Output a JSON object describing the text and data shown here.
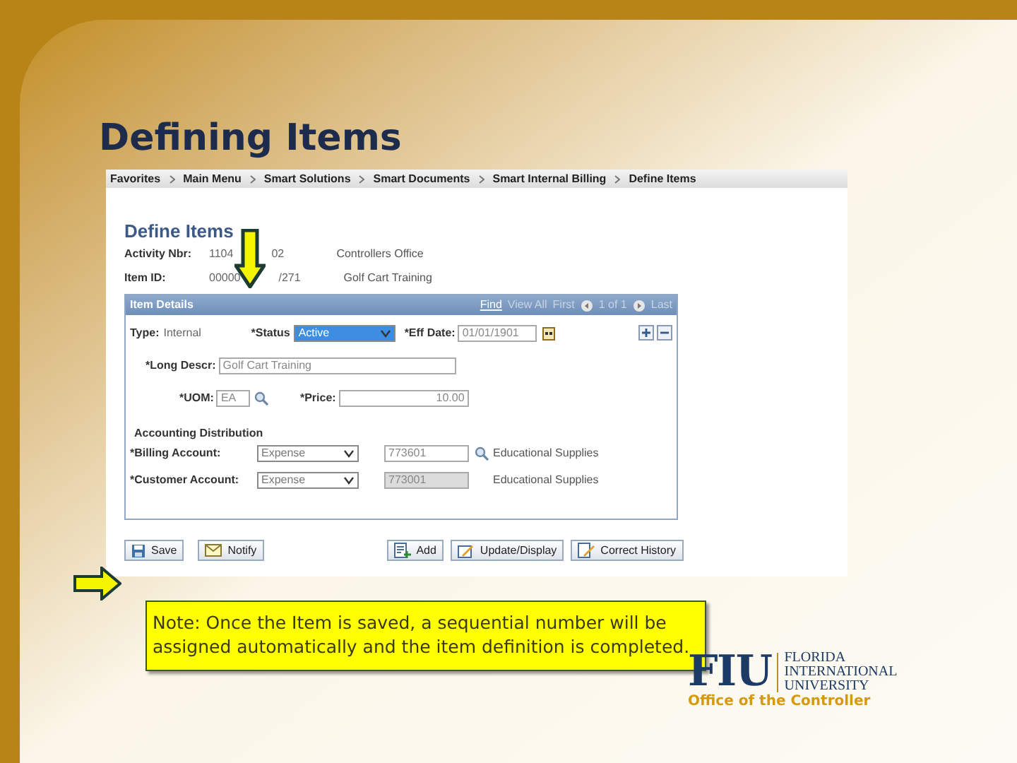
{
  "slide_title": "Defining Items",
  "breadcrumbs": [
    "Favorites",
    "Main Menu",
    "Smart Solutions",
    "Smart Documents",
    "Smart Internal Billing",
    "Define Items"
  ],
  "page_title": "Define Items",
  "header_fields": [
    {
      "label": "Activity Nbr:",
      "value_start": "1104",
      "value_end": "02",
      "description": "Controllers Office"
    },
    {
      "label": "Item ID:",
      "value_start": "00000",
      "value_end": "/271",
      "description": "Golf Cart Training"
    }
  ],
  "item_details": {
    "title": "Item Details",
    "nav": [
      "Find",
      "View All",
      "First",
      "1 of 1",
      "Last"
    ],
    "type_label": "Type:",
    "type_value": "Internal",
    "status": {
      "label": "*Status",
      "value": "Active"
    },
    "eff_date": {
      "label": "*Eff Date:",
      "value": "01/01/1901"
    },
    "long_descr": {
      "label": "*Long Descr:",
      "value": "Golf Cart Training"
    },
    "uom": {
      "label": "*UOM:",
      "value": "EA"
    },
    "price": {
      "label": "*Price:",
      "value": "10.00"
    },
    "section": "Accounting Distribution",
    "accounts": [
      {
        "label": "*Billing Account:",
        "type": "Expense",
        "account": "773601",
        "disabled": false,
        "description": "Educational Supplies"
      },
      {
        "label": "*Customer Account:",
        "type": "Expense",
        "account": "773001",
        "disabled": true,
        "description": "Educational Supplies"
      }
    ]
  },
  "buttons_left": [
    {
      "label": "Save",
      "kind": "save"
    },
    {
      "label": "Notify",
      "kind": "notify"
    }
  ],
  "buttons_right": [
    {
      "label": "Add",
      "kind": "add"
    },
    {
      "label": "Update/Display",
      "kind": "update"
    },
    {
      "label": "Correct History",
      "kind": "history"
    }
  ],
  "note": "Note: Once the Item is saved, a sequential number will be assigned automatically and the item definition is completed.",
  "logo": {
    "letters": "FIU",
    "lines": [
      "FLORIDA",
      "INTERNATIONAL",
      "UNIVERSITY"
    ],
    "tagline": "Office of the Controller"
  }
}
